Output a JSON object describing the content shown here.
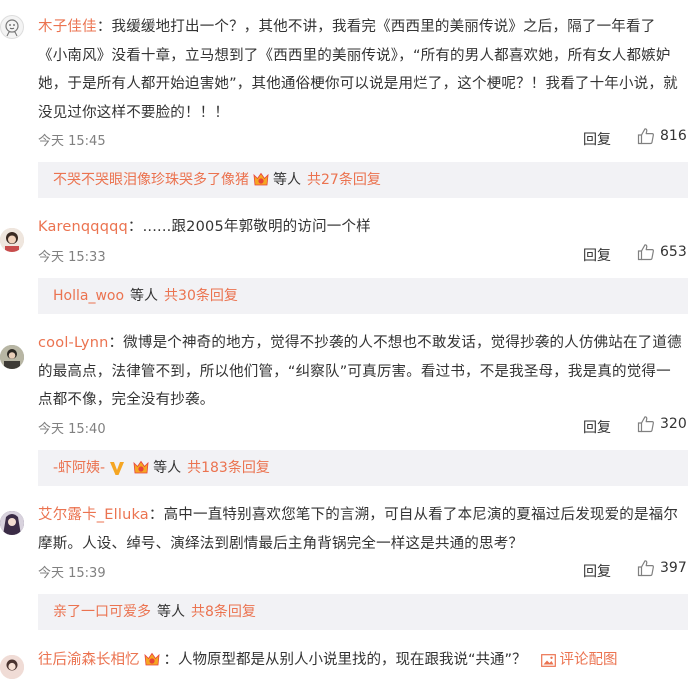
{
  "comments": [
    {
      "user": "木子佳佳",
      "text_lines": [
        "：我缓缓地打出一个？，其他不讲，我看完《西西里的美丽传说》之后，隔了一年看了",
        "《小南风》没看十章，立马想到了《西西里的美丽传说》，“所有的男人都喜欢她，所有女人都嫉妒",
        "她，于是所有人都开始迫害她”，其他通俗梗你可以说是用烂了，这个梗呢？！我看了十年小说，就",
        "没见过你这样不要脸的！！！"
      ],
      "time": "今天 15:45",
      "reply_label": "回复",
      "likes": "816",
      "replies_user": "不哭不哭眼泪像珍珠哭多了像猪",
      "replies_mid": "等人",
      "replies_count": "共27条回复"
    },
    {
      "user": "Karenqqqqq",
      "text_lines": [
        "：......跟2005年郭敬明的访问一个样"
      ],
      "time": "今天 15:33",
      "reply_label": "回复",
      "likes": "653",
      "replies_user": "Holla_woo",
      "replies_mid": "等人",
      "replies_count": "共30条回复"
    },
    {
      "user": "cool-Lynn",
      "text_lines": [
        "：微博是个神奇的地方，觉得不抄袭的人不想也不敢发话，觉得抄袭的人仿佛站在了道德",
        "的最高点，法律管不到，所以他们管，“纠察队”可真厉害。看过书，不是我圣母，我是真的觉得一",
        "点都不像，完全没有抄袭。"
      ],
      "time": "今天 15:40",
      "reply_label": "回复",
      "likes": "320",
      "replies_user": "-虾阿姨-",
      "replies_mid": "等人",
      "replies_count": "共183条回复"
    },
    {
      "user": "艾尔露卡_Elluka",
      "text_lines": [
        "：高中一直特别喜欢您笔下的言溯，可自从看了本尼演的夏福过后发现爱的是福尔",
        "摩斯。人设、绰号、演绎法到剧情最后主角背锅完全一样这是共通的思考？"
      ],
      "time": "今天 15:39",
      "reply_label": "回复",
      "likes": "397",
      "replies_user": "亲了一口可爱多",
      "replies_mid": "等人",
      "replies_count": "共8条回复"
    },
    {
      "user": "往后渝森长相忆",
      "text_lines": [
        "：人物原型都是从别人小说里找的，现在跟我说“共通”？"
      ],
      "pic_link": "评论配图"
    }
  ],
  "colors": {
    "link": "#eb7350",
    "text": "#333333",
    "time": "#808080",
    "reply_bg": "#f2f2f5",
    "badge_yellow": "#f5a623",
    "badge_red": "#e8433b"
  },
  "icons": [
    "thumbs-up-icon",
    "membership-badge-icon",
    "vip-v-icon",
    "picture-icon"
  ]
}
